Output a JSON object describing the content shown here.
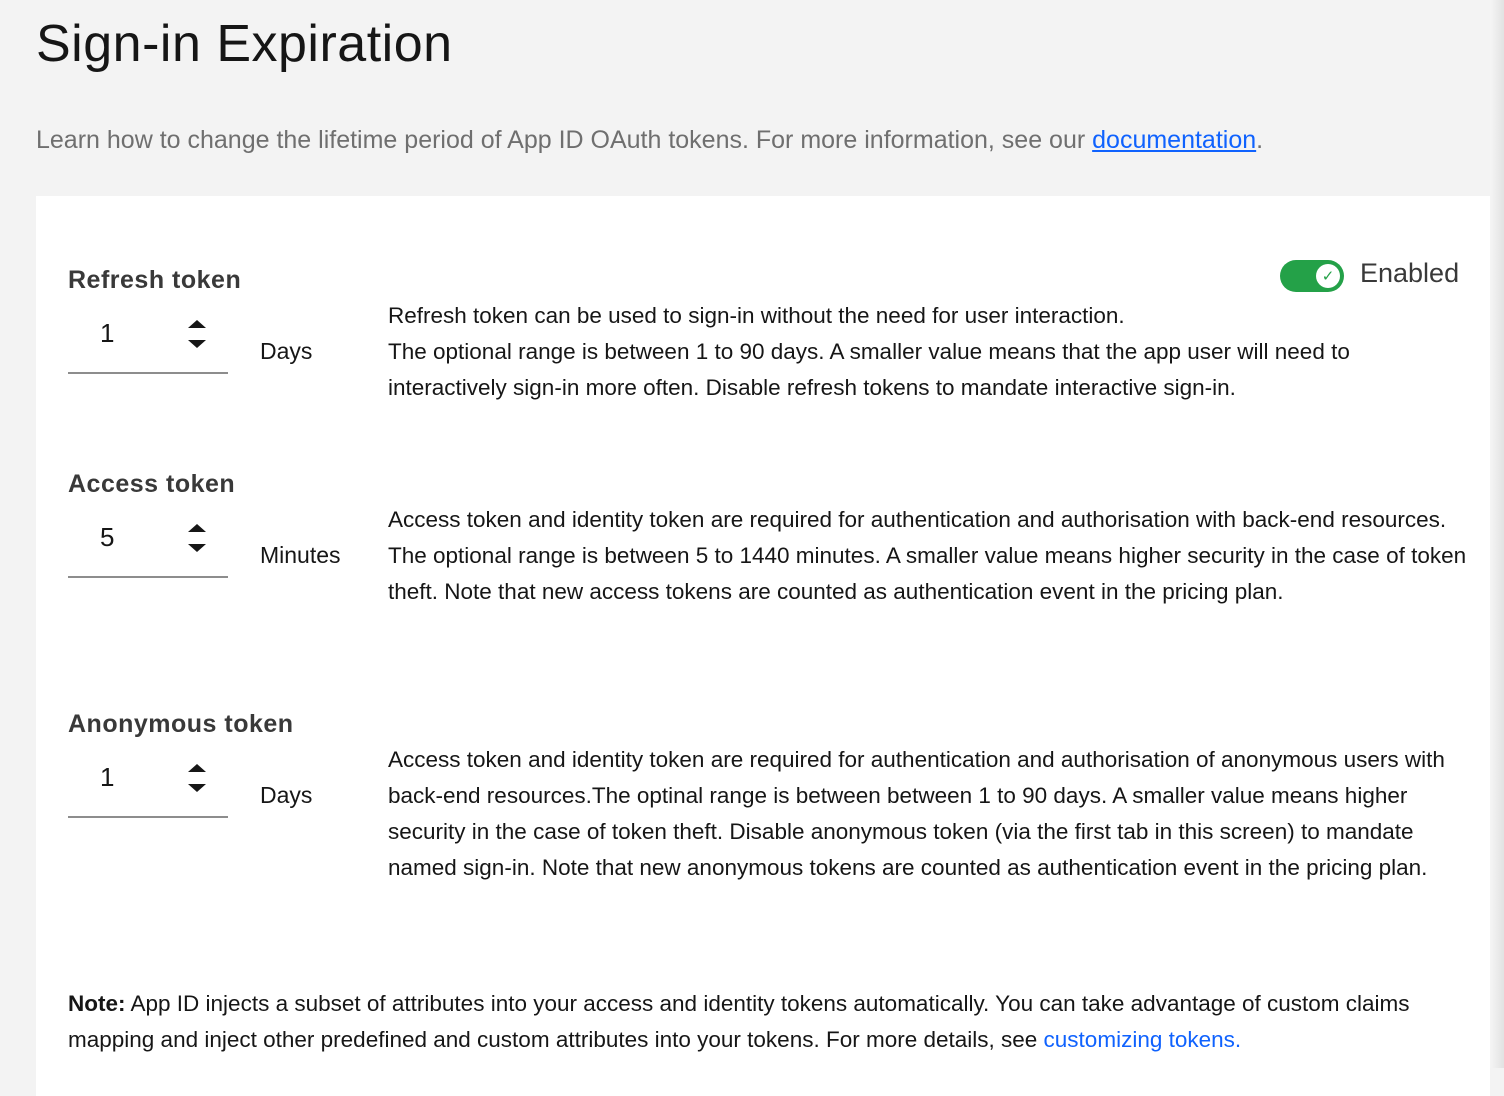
{
  "header": {
    "title": "Sign-in Expiration",
    "subtitle": "Learn how to change the lifetime period of App ID OAuth tokens. For more information, see our ",
    "subtitle_link": "documentation",
    "subtitle_end": "."
  },
  "toggle": {
    "label": "Enabled",
    "state": true,
    "color": "#24a148"
  },
  "tokens": [
    {
      "label": "Refresh token",
      "value": "1",
      "unit": "Days",
      "description": "Refresh token can be used to sign-in without the need for user interaction.\nThe optional range is between 1 to 90 days. A smaller value means that the app user will need to interactively sign-in more often. Disable refresh tokens to mandate interactive sign-in."
    },
    {
      "label": "Access token",
      "value": "5",
      "unit": "Minutes",
      "description": "Access token and identity token are required for authentication and authorisation with back-end resources. The optional range is between 5 to 1440 minutes. A smaller value means higher security in the case of token theft. Note that new access tokens are counted as authentication event in the pricing plan."
    },
    {
      "label": "Anonymous token",
      "value": "1",
      "unit": "Days",
      "description": "Access token and identity token are required for authentication and authorisation of anonymous users with back-end resources.The optinal range is between between 1 to 90 days. A smaller value means higher security in the case of token theft. Disable anonymous token (via the first tab in this screen) to mandate named sign-in. Note that new anonymous tokens are counted as authentication event in the pricing plan."
    }
  ],
  "note": {
    "bold": "Note:",
    "text": " App ID injects a subset of attributes into your access and identity tokens automatically. You can take advantage of custom claims mapping and inject other predefined and custom attributes into your tokens. For more details, see ",
    "link": "customizing tokens."
  }
}
